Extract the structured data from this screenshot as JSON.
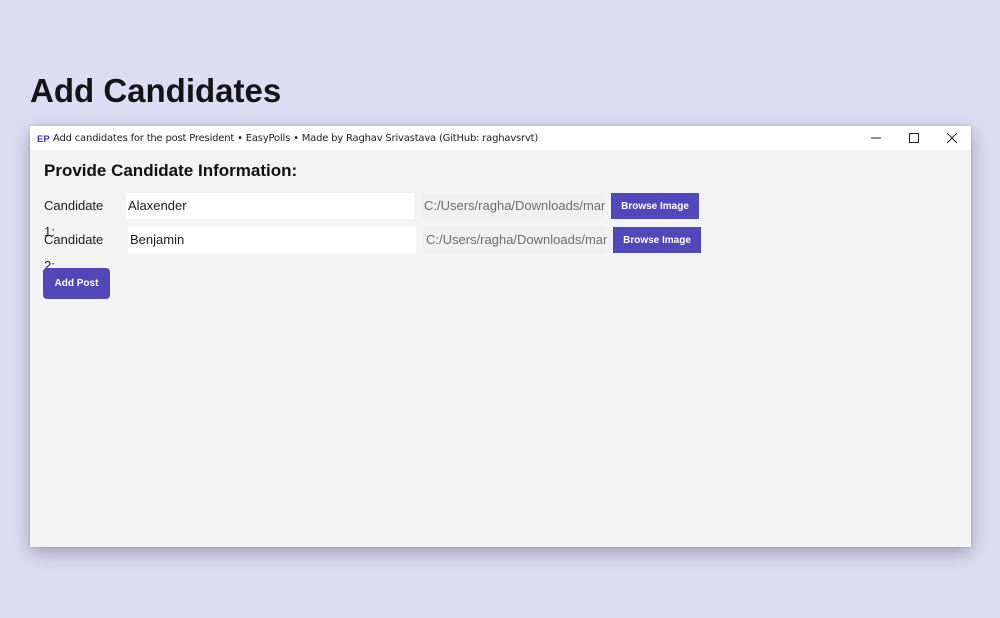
{
  "page_heading": "Add Candidates",
  "window": {
    "title": "Add candidates for the post President  •  EasyPolls  •  Made by Raghav Srivastava (GitHub: raghavsrvt)",
    "icon_name": "easypolls-logo-icon",
    "icon_text": "EP",
    "controls": [
      "minimize-icon",
      "maximize-icon",
      "close-icon"
    ]
  },
  "form": {
    "heading": "Provide Candidate Information:",
    "candidates": [
      {
        "label": "Candidate 1:",
        "name": "Alaxender",
        "image_path": "C:/Users/ragha/Downloads/man-",
        "browse_label": "Browse Image"
      },
      {
        "label": "Candidate 2:",
        "name": "Benjamin",
        "image_path": "C:/Users/ragha/Downloads/man-",
        "browse_label": "Browse Image"
      }
    ],
    "submit_label": "Add Post"
  },
  "colors": {
    "accent": "#5147b9",
    "background": "#dedcf2",
    "window_bg": "#f3f3f3"
  }
}
